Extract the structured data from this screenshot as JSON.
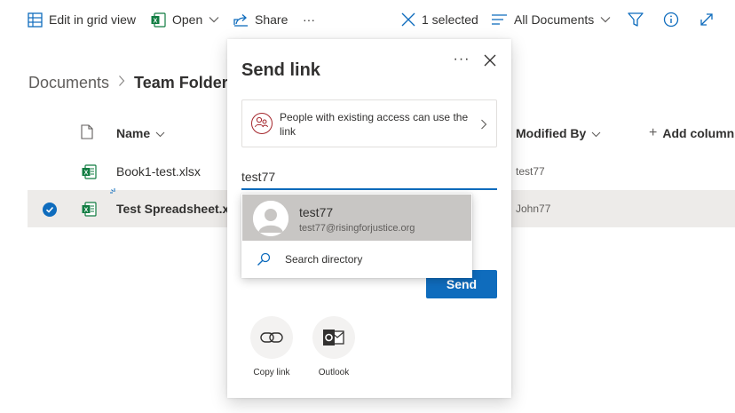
{
  "toolbar": {
    "edit_grid": "Edit in grid view",
    "open": "Open",
    "share": "Share",
    "more": "···",
    "selected": "1 selected",
    "view": "All Documents"
  },
  "breadcrumb": {
    "root": "Documents",
    "current": "Team Folder"
  },
  "list": {
    "columns": {
      "name": "Name",
      "modified_by": "Modified By",
      "add_column": "Add column"
    },
    "rows": [
      {
        "name": "Book1-test.xlsx",
        "modified_by": "test77",
        "selected": false
      },
      {
        "name": "Test Spreadsheet.xlsx",
        "modified_by": "John77",
        "selected": true
      }
    ]
  },
  "dialog": {
    "title": "Send link",
    "more": "···",
    "access_text": "People with existing access can use the link",
    "to_value": "test77",
    "send_label": "Send",
    "options": [
      {
        "label": "Copy link"
      },
      {
        "label": "Outlook"
      }
    ]
  },
  "suggestion": {
    "name": "test77",
    "email": "test77@risingforjustice.org",
    "search_directory": "Search directory"
  },
  "colors": {
    "accent": "#0f6cbd",
    "excel": "#107c41",
    "selected_row": "#edebe9",
    "access_icon": "#a4262c"
  }
}
